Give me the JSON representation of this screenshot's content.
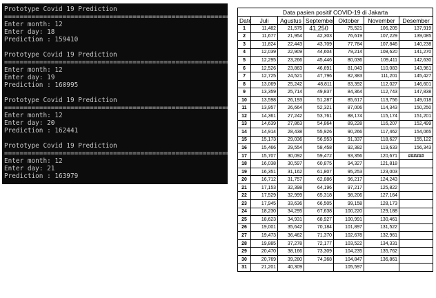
{
  "terminal": {
    "lines": [
      "Prototype Covid 19 Prediction",
      "============================================================",
      "Enter month: 12",
      "Enter day: 18",
      "Prediction : 159410",
      "",
      "Prototype Covid 19 Prediction",
      "============================================================",
      "Enter month: 12",
      "Enter day: 19",
      "Prediction : 160995",
      "",
      "Prototype Covid 19 Prediction",
      "============================================================",
      "Enter month: 12",
      "Enter day: 20",
      "Prediction : 162441",
      "",
      "Prototype Covid 19 Prediction",
      "============================================================",
      "Enter month: 12",
      "Enter day: 21",
      "Prediction : 163979"
    ]
  },
  "sheet": {
    "title": "Data pasien positif COVID-19 di Jakarta",
    "headers": [
      "Date",
      "Juli",
      "Agustus",
      "September",
      "Oktober",
      "November",
      "Desember"
    ],
    "rows": [
      [
        "1",
        "11,482",
        "21,575",
        "41,250",
        "75,521",
        "106,205",
        "137,919"
      ],
      [
        "2",
        "11,677",
        "21,954",
        "42,303",
        "76,619",
        "107,229",
        "139,085"
      ],
      [
        "3",
        "11,824",
        "22,443",
        "43,709",
        "77,784",
        "107,846",
        "140,238"
      ],
      [
        "4",
        "12,039",
        "22,909",
        "44,604",
        "79,214",
        "108,620",
        "141,270"
      ],
      [
        "5",
        "12,295",
        "23,266",
        "45,446",
        "80,036",
        "109,411",
        "142,630"
      ],
      [
        "6",
        "12,526",
        "23,863",
        "46,691",
        "81,043",
        "110,083",
        "143,961"
      ],
      [
        "7",
        "12,725",
        "24,521",
        "47,796",
        "82,383",
        "111,201",
        "145,427"
      ],
      [
        "8",
        "13,069",
        "25,242",
        "48,811",
        "83,392",
        "112,027",
        "146,601"
      ],
      [
        "9",
        "13,359",
        "25,714",
        "49,837",
        "84,364",
        "112,743",
        "147,838"
      ],
      [
        "10",
        "13,598",
        "26,193",
        "51,287",
        "85,617",
        "113,756",
        "149,018"
      ],
      [
        "11",
        "13,957",
        "26,664",
        "52,321",
        "87,006",
        "114,343",
        "150,250"
      ],
      [
        "12",
        "14,361",
        "27,242",
        "53,761",
        "88,174",
        "115,174",
        "151,201"
      ],
      [
        "13",
        "14,639",
        "27,863",
        "54,864",
        "89,228",
        "116,207",
        "152,499"
      ],
      [
        "14",
        "14,914",
        "28,438",
        "55,926",
        "90,266",
        "117,462",
        "154,065"
      ],
      [
        "15",
        "15,173",
        "29,036",
        "56,953",
        "91,337",
        "118,627",
        "155,122"
      ],
      [
        "16",
        "15,466",
        "29,554",
        "58,458",
        "92,382",
        "119,633",
        "156,343"
      ],
      [
        "17",
        "15,707",
        "30,092",
        "59,472",
        "93,356",
        "120,671",
        "######"
      ],
      [
        "18",
        "16,038",
        "30,597",
        "60,875",
        "94,327",
        "121,818",
        ""
      ],
      [
        "19",
        "16,351",
        "31,162",
        "61,807",
        "95,253",
        "123,003",
        ""
      ],
      [
        "20",
        "16,712",
        "31,757",
        "62,886",
        "96,217",
        "124,243",
        ""
      ],
      [
        "21",
        "17,153",
        "32,398",
        "64,196",
        "97,217",
        "125,822",
        ""
      ],
      [
        "22",
        "17,529",
        "32,999",
        "65,318",
        "98,206",
        "127,164",
        ""
      ],
      [
        "23",
        "17,945",
        "33,636",
        "66,505",
        "99,158",
        "128,173",
        ""
      ],
      [
        "24",
        "18,230",
        "34,295",
        "67,638",
        "100,220",
        "129,188",
        ""
      ],
      [
        "25",
        "18,623",
        "34,931",
        "68,927",
        "100,991",
        "130,461",
        ""
      ],
      [
        "26",
        "19,001",
        "35,642",
        "70,184",
        "101,897",
        "131,522",
        ""
      ],
      [
        "27",
        "19,473",
        "36,462",
        "71,370",
        "102,678",
        "132,961",
        ""
      ],
      [
        "28",
        "19,885",
        "37,278",
        "72,177",
        "103,522",
        "134,331",
        ""
      ],
      [
        "29",
        "20,470",
        "38,166",
        "73,309",
        "104,235",
        "135,762",
        ""
      ],
      [
        "30",
        "20,769",
        "39,280",
        "74,368",
        "104,847",
        "136,861",
        ""
      ],
      [
        "31",
        "21,201",
        "40,309",
        "",
        "105,597",
        "",
        ""
      ]
    ]
  }
}
